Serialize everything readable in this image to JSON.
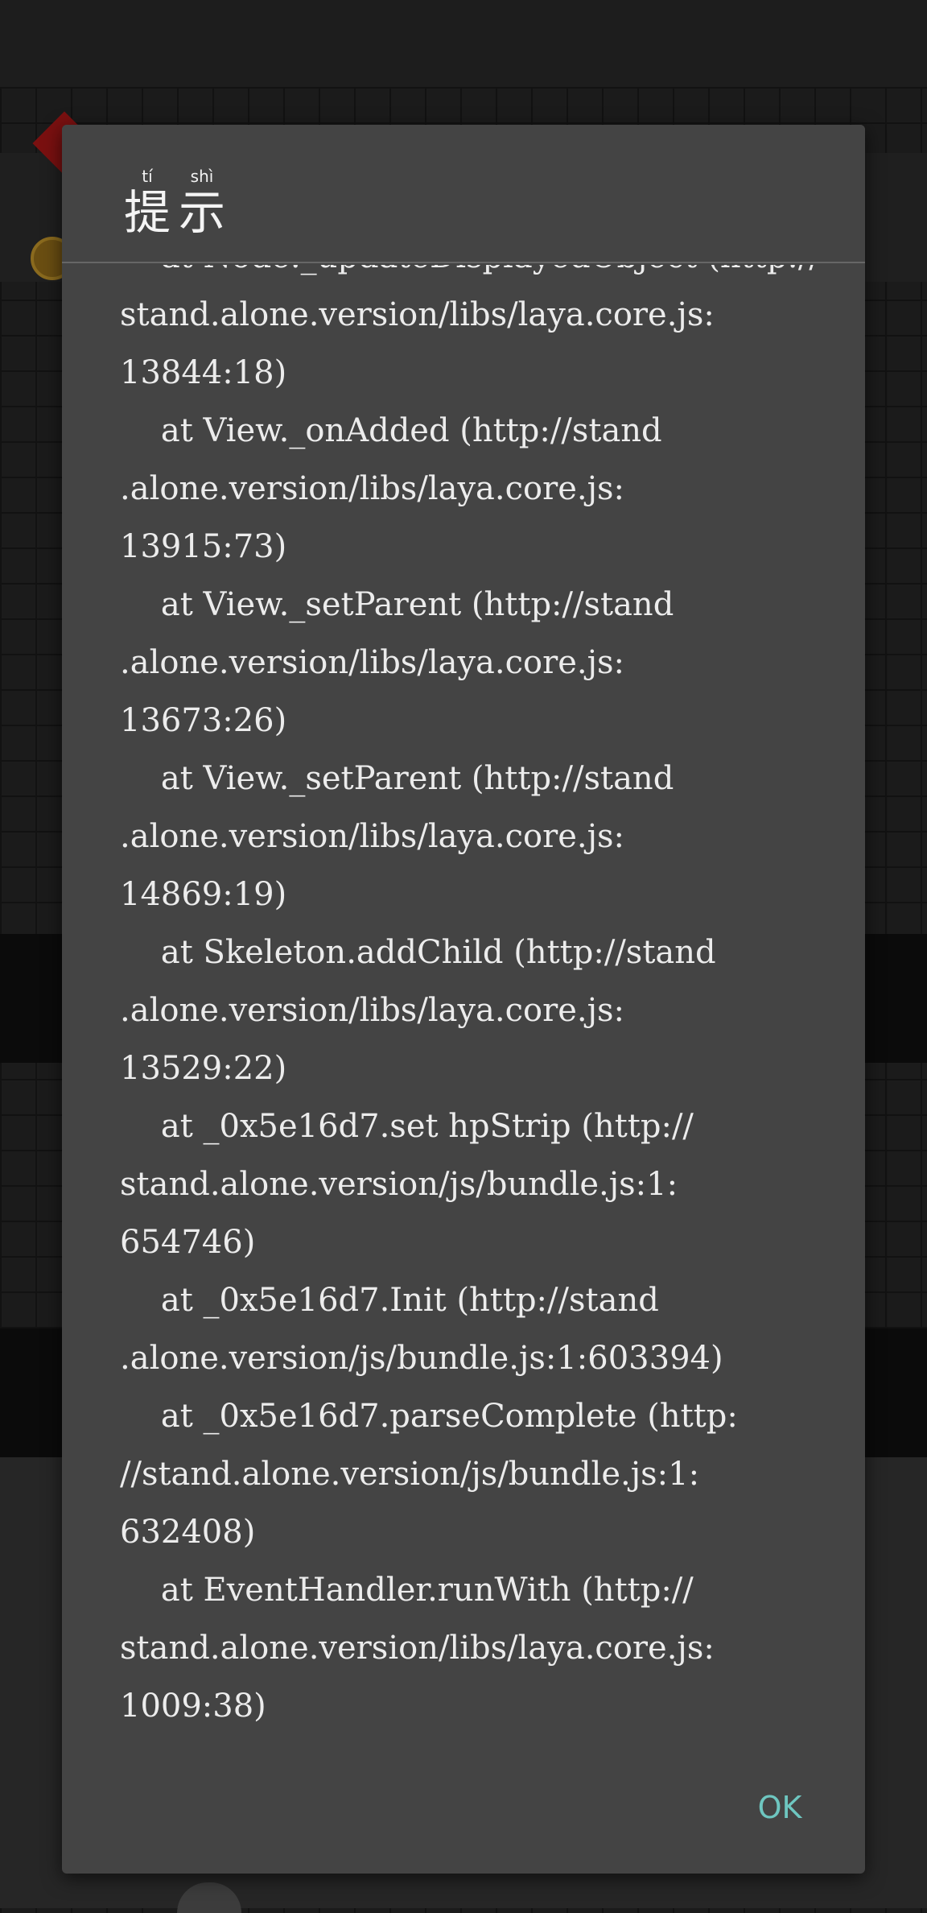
{
  "dialog": {
    "title_chars": [
      {
        "pinyin": "tí",
        "char": "提"
      },
      {
        "pinyin": "shì",
        "char": "示"
      }
    ],
    "message_lines": [
      "    at Node._updateDisplayedObject (http://",
      "stand.alone.version/libs/laya.core.js:",
      "13844:18)",
      "    at View._onAdded (http://stand",
      ".alone.version/libs/laya.core.js:",
      "13915:73)",
      "    at View._setParent (http://stand",
      ".alone.version/libs/laya.core.js:",
      "13673:26)",
      "    at View._setParent (http://stand",
      ".alone.version/libs/laya.core.js:",
      "14869:19)",
      "    at Skeleton.addChild (http://stand",
      ".alone.version/libs/laya.core.js:",
      "13529:22)",
      "    at _0x5e16d7.set hpStrip (http://",
      "stand.alone.version/js/bundle.js:1:",
      "654746)",
      "    at _0x5e16d7.Init (http://stand",
      ".alone.version/js/bundle.js:1:603394)",
      "    at _0x5e16d7.parseComplete (http:",
      "//stand.alone.version/js/bundle.js:1:",
      "632408)",
      "    at EventHandler.runWith (http://",
      "stand.alone.version/libs/laya.core.js:",
      "1009:38)"
    ],
    "ok_label": "OK",
    "ok_color": "#6ec6c0"
  }
}
